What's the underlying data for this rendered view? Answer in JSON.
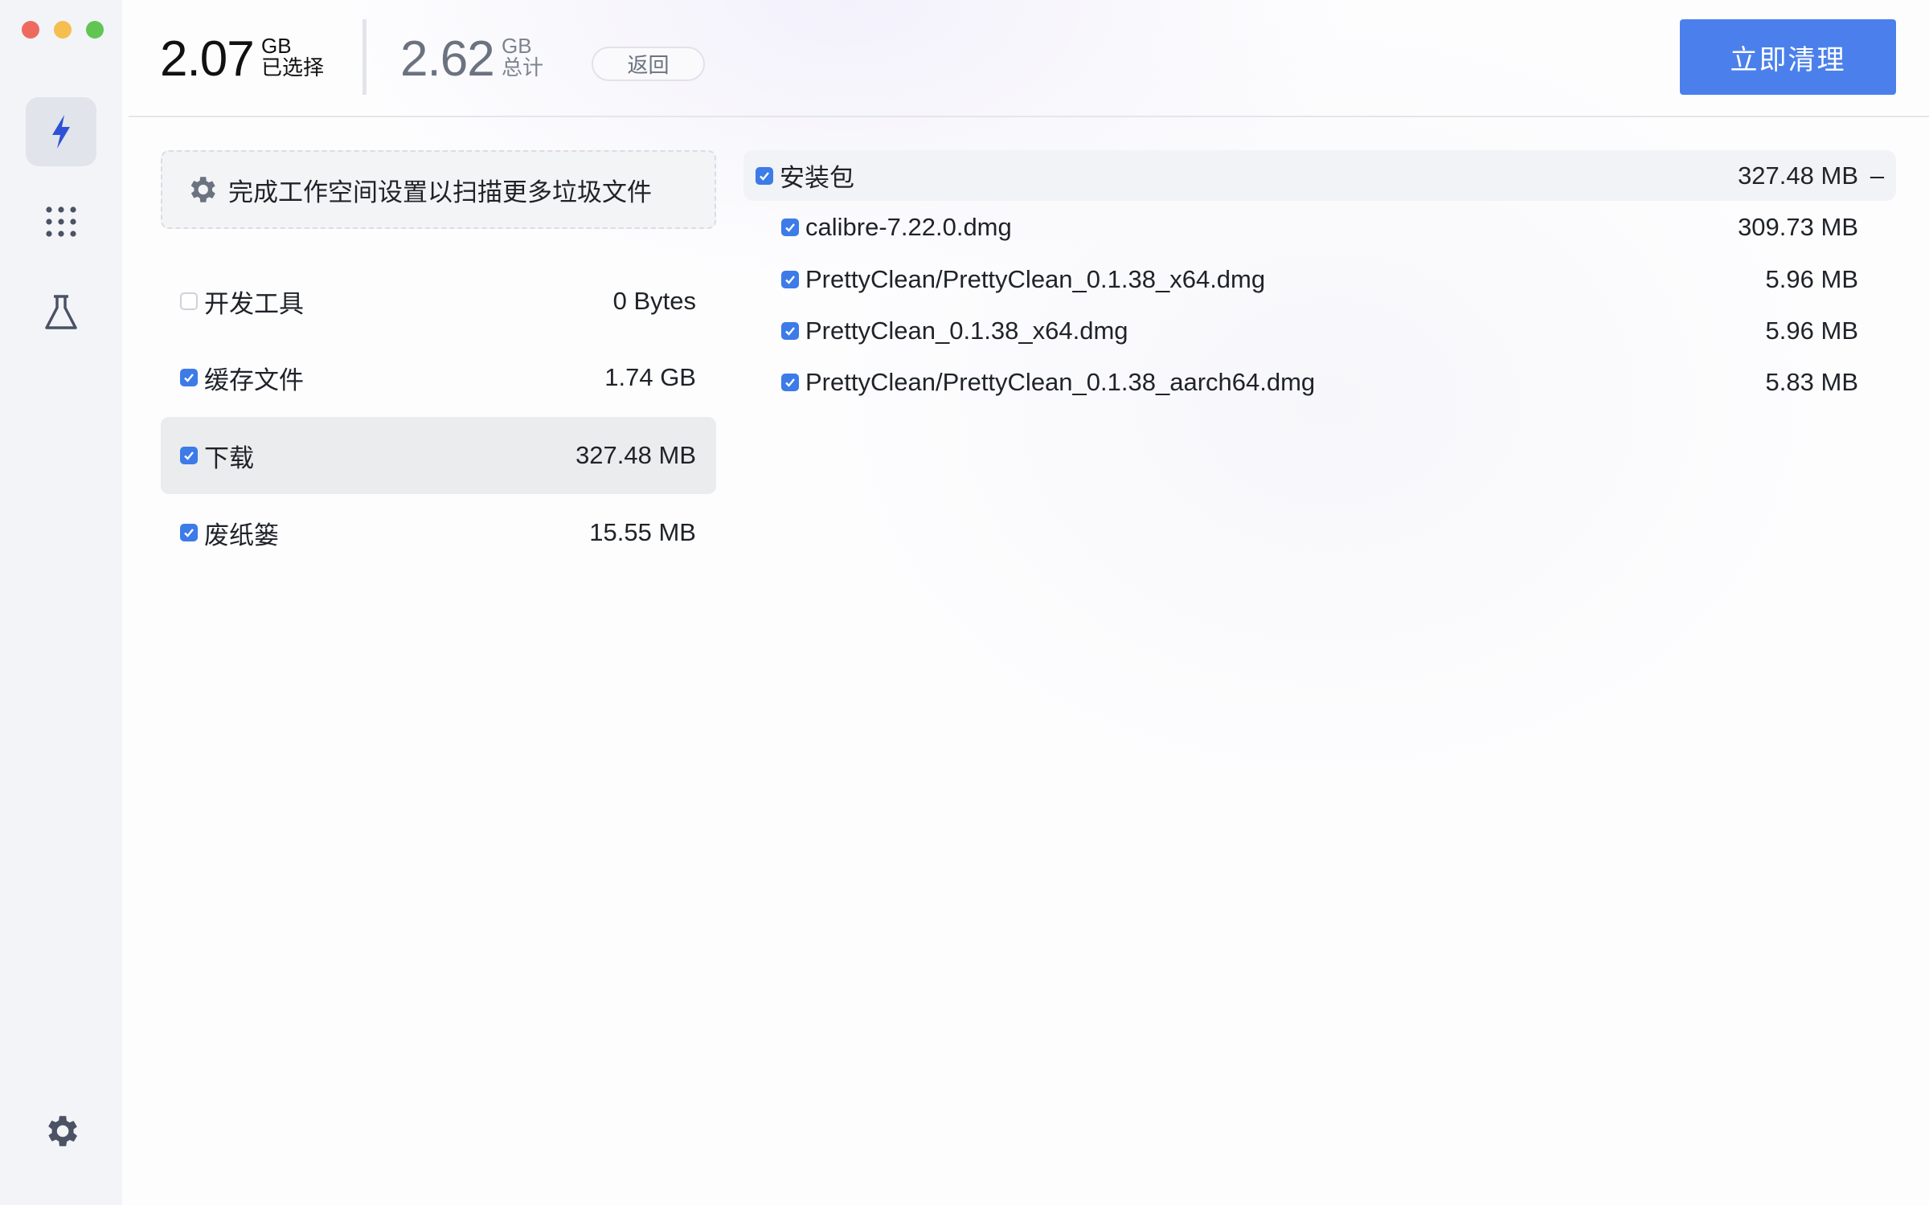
{
  "window": {
    "traffic_lights": {
      "close": "#ee6a5f",
      "minimize": "#f5be4f",
      "zoom": "#61c554"
    }
  },
  "sidebar": {
    "items": [
      {
        "icon": "lightning-icon",
        "active": true
      },
      {
        "icon": "grid-dots-icon"
      },
      {
        "icon": "flask-icon"
      }
    ],
    "settings_icon": "gear-icon"
  },
  "header": {
    "selected_value": "2.07",
    "selected_unit": "GB",
    "selected_label": "已选择",
    "total_value": "2.62",
    "total_unit": "GB",
    "total_label": "总计",
    "back_label": "返回",
    "clean_label": "立即清理"
  },
  "banner": {
    "text": "完成工作空间设置以扫描更多垃圾文件"
  },
  "categories": [
    {
      "label": "开发工具",
      "size": "0 Bytes",
      "checked": false,
      "selected": false
    },
    {
      "label": "缓存文件",
      "size": "1.74 GB",
      "checked": true,
      "selected": false
    },
    {
      "label": "下载",
      "size": "327.48 MB",
      "checked": true,
      "selected": true
    },
    {
      "label": "废纸篓",
      "size": "15.55 MB",
      "checked": true,
      "selected": false
    }
  ],
  "detail": {
    "group": {
      "label": "安装包",
      "size": "327.48 MB",
      "collapse_symbol": "–",
      "checked": true
    },
    "files": [
      {
        "name": "calibre-7.22.0.dmg",
        "size": "309.73 MB",
        "checked": true
      },
      {
        "name": "PrettyClean/PrettyClean_0.1.38_x64.dmg",
        "size": "5.96 MB",
        "checked": true
      },
      {
        "name": "PrettyClean_0.1.38_x64.dmg",
        "size": "5.96 MB",
        "checked": true
      },
      {
        "name": "PrettyClean/PrettyClean_0.1.38_aarch64.dmg",
        "size": "5.83 MB",
        "checked": true
      }
    ]
  },
  "colors": {
    "accent": "#4b80ec",
    "checkbox": "#3c7be8",
    "sidebar_bg": "#f2f4f8"
  }
}
